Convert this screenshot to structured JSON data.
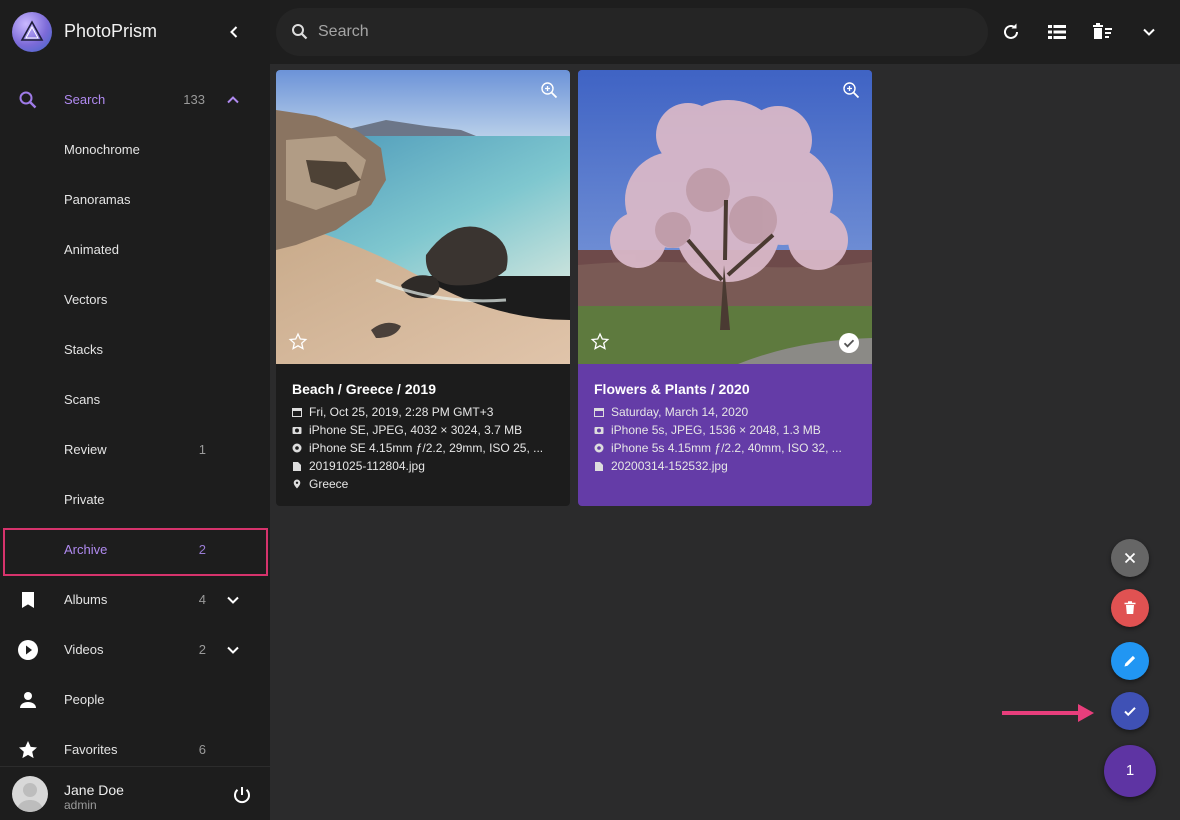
{
  "app": {
    "title": "PhotoPrism"
  },
  "sidebar": {
    "search": {
      "label": "Search",
      "count": "133"
    },
    "items": [
      {
        "label": "Monochrome",
        "count": ""
      },
      {
        "label": "Panoramas",
        "count": ""
      },
      {
        "label": "Animated",
        "count": ""
      },
      {
        "label": "Vectors",
        "count": ""
      },
      {
        "label": "Stacks",
        "count": ""
      },
      {
        "label": "Scans",
        "count": ""
      },
      {
        "label": "Review",
        "count": "1"
      },
      {
        "label": "Private",
        "count": ""
      },
      {
        "label": "Archive",
        "count": "2"
      }
    ],
    "albums": {
      "label": "Albums",
      "count": "4"
    },
    "videos": {
      "label": "Videos",
      "count": "2"
    },
    "people": {
      "label": "People"
    },
    "favorites": {
      "label": "Favorites",
      "count": "6"
    },
    "user": {
      "name": "Jane Doe",
      "role": "admin"
    }
  },
  "toolbar": {
    "search_placeholder": "Search"
  },
  "photos": [
    {
      "title": "Beach / Greece / 2019",
      "date": "Fri, Oct 25, 2019, 2:28 PM GMT+3",
      "camera": "iPhone SE, JPEG, 4032 × 3024, 3.7 MB",
      "lens": "iPhone SE 4.15mm ƒ/2.2, 29mm, ISO 25, ...",
      "file": "20191025-112804.jpg",
      "location": "Greece",
      "selected": false
    },
    {
      "title": "Flowers & Plants / 2020",
      "date": "Saturday, March 14, 2020",
      "camera": "iPhone 5s, JPEG, 1536 × 2048, 1.3 MB",
      "lens": "iPhone 5s 4.15mm ƒ/2.2, 40mm, ISO 32, ...",
      "file": "20200314-152532.jpg",
      "selected": true
    }
  ],
  "selection": {
    "count": "1"
  },
  "colors": {
    "accent": "#b08af0",
    "selected_card": "#643ca7",
    "fab_close": "#666666",
    "fab_delete": "#e05252",
    "fab_edit": "#2196f3",
    "fab_select": "#3f51b5",
    "fab_count": "#5e34a3",
    "highlight": "#d6336c"
  },
  "icons": [
    "search-icon",
    "chevron-left-icon",
    "chevron-up-icon",
    "chevron-down-icon",
    "bookmark-icon",
    "play-circle-icon",
    "person-icon",
    "star-icon",
    "power-icon",
    "refresh-icon",
    "list-view-icon",
    "delete-sweep-icon",
    "zoom-in-icon",
    "check-circle-icon",
    "calendar-icon",
    "camera-icon",
    "aperture-icon",
    "file-icon",
    "location-icon",
    "close-icon",
    "trash-icon",
    "pencil-icon",
    "check-icon"
  ]
}
